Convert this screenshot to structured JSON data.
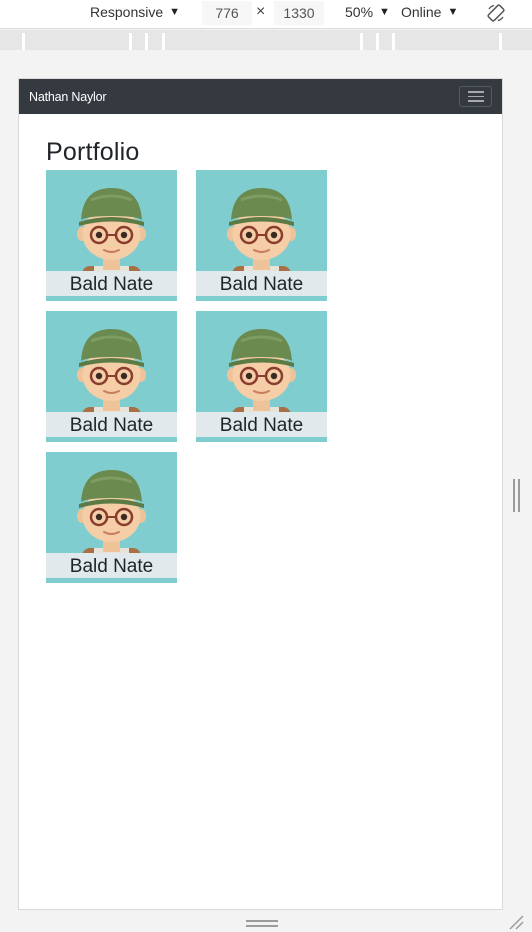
{
  "devtools": {
    "device": "Responsive",
    "width": "776",
    "height": "1330",
    "times": "×",
    "zoom": "50%",
    "throttle": "Online"
  },
  "navbar": {
    "brand": "Nathan Naylor"
  },
  "main": {
    "title": "Portfolio",
    "cards": [
      {
        "caption": "Bald Nate"
      },
      {
        "caption": "Bald Nate"
      },
      {
        "caption": "Bald Nate"
      },
      {
        "caption": "Bald Nate"
      },
      {
        "caption": "Bald Nate"
      }
    ]
  },
  "colors": {
    "navbar_bg": "#343a40",
    "card_bg": "#80cdd0",
    "caption_bg": "#e1e9ec"
  },
  "icons": [
    "caret-down-icon",
    "rotate-device-icon",
    "hamburger-menu-icon",
    "avatar-image"
  ]
}
